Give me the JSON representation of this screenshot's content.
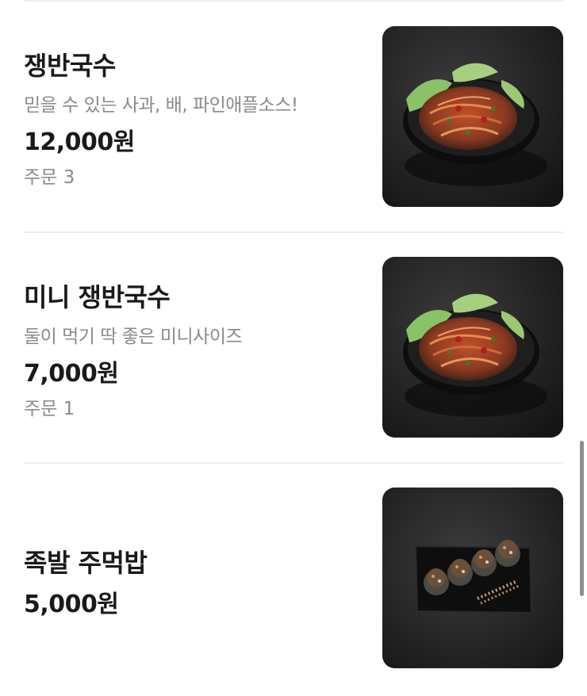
{
  "menu": {
    "items": [
      {
        "name": "쟁반국수",
        "description": "믿을 수 있는 사과, 배, 파인애플소스!",
        "price": "12,000원",
        "orders": "주문 3",
        "image_icon": "noodle-bowl-photo"
      },
      {
        "name": "미니 쟁반국수",
        "description": "둘이 먹기 딱 좋은 미니사이즈",
        "price": "7,000원",
        "orders": "주문 1",
        "image_icon": "noodle-bowl-photo"
      },
      {
        "name": "족발 주먹밥",
        "price": "5,000원",
        "image_icon": "rice-ball-plate-photo"
      }
    ]
  },
  "colors": {
    "text_primary": "#1a1a1a",
    "text_secondary": "#8a8a8a",
    "divider": "#ededed",
    "photo_background": "#1b1b1b"
  }
}
